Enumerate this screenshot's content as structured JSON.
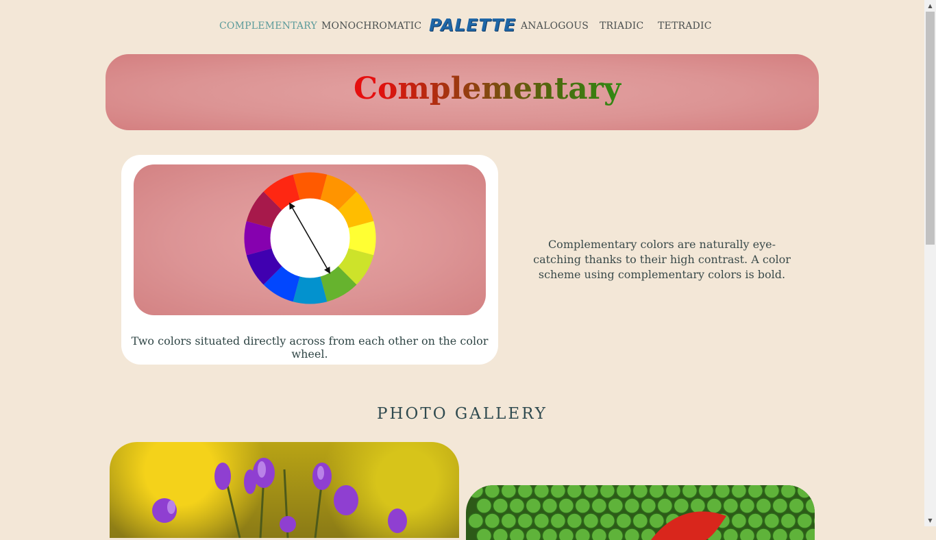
{
  "nav": {
    "items": [
      {
        "label": "COMPLEMENTARY",
        "active": true
      },
      {
        "label": "MONOCHROMATIC",
        "active": false
      },
      {
        "label": "ANALOGOUS",
        "active": false
      },
      {
        "label": "TRIADIC",
        "active": false
      },
      {
        "label": "TETRADIC",
        "active": false
      }
    ],
    "logo": "PALETTE"
  },
  "hero": {
    "title": "Complementary"
  },
  "card": {
    "caption": "Two colors situated directly across from each other on the color wheel.",
    "wheel_colors": [
      "#ff5a00",
      "#ff9400",
      "#ffbd00",
      "#ffff33",
      "#cde32a",
      "#66b32e",
      "#0392ce",
      "#0247fe",
      "#4000b0",
      "#8601af",
      "#a7194b",
      "#fe2712"
    ]
  },
  "description": "Complementary colors are naturally eye-catching thanks to their high contrast. A color scheme using complementary colors is bold.",
  "gallery": {
    "heading": "PHOTO GALLERY"
  },
  "colors": {
    "background": "#f3e7d7",
    "nav_active": "#5b9a9a",
    "logo": "#1f66a6",
    "hero_panel": "#dc9494"
  },
  "icons": {
    "scroll_up": "triangle-up",
    "scroll_down": "triangle-down"
  }
}
